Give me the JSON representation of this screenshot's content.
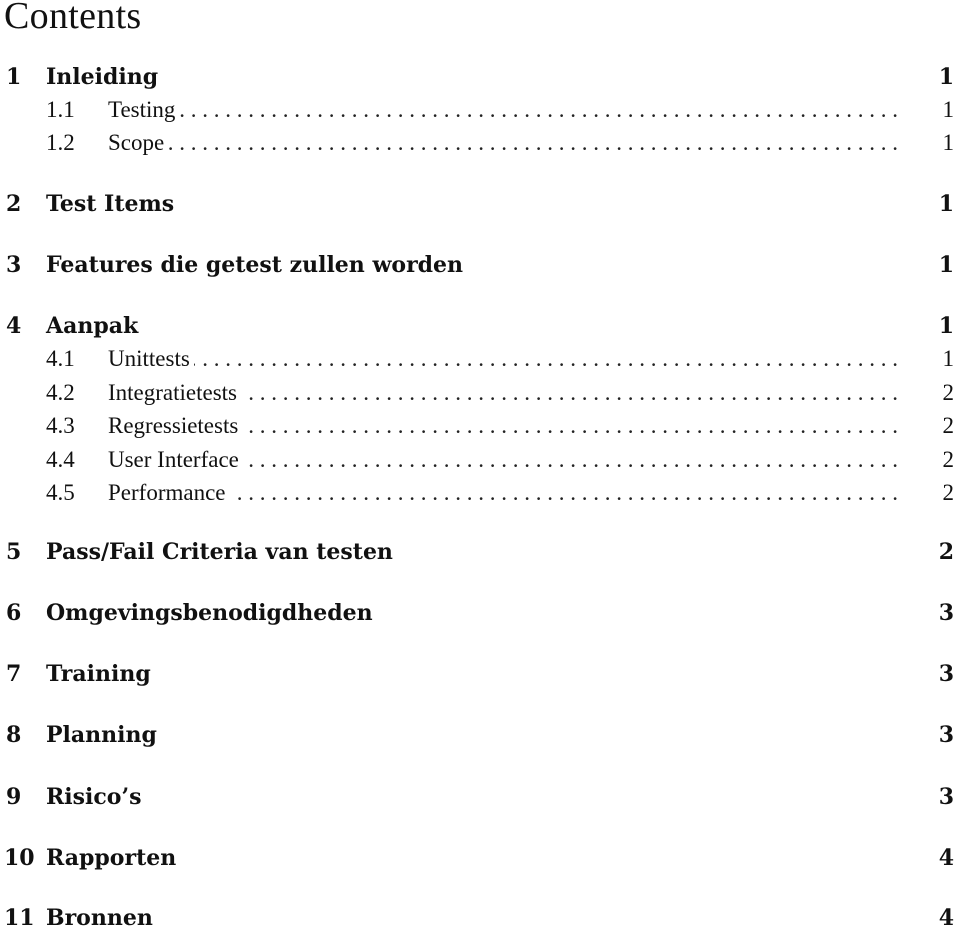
{
  "document": {
    "title": "Contents",
    "leader_text": ". . . . . . . . . . . . . . . . . . . . . . . . . . . . . . . . . . . . . . . . . . . . . . . . . . . . . . . . . . . . . . . . . . . . . . . .",
    "entries": [
      {
        "level": 1,
        "number": "1",
        "label": "Inleiding",
        "page": "1"
      },
      {
        "level": 2,
        "number": "1.1",
        "label": "Testing",
        "page": "1"
      },
      {
        "level": 2,
        "number": "1.2",
        "label": "Scope",
        "page": "1"
      },
      {
        "level": 1,
        "number": "2",
        "label": "Test Items",
        "page": "1"
      },
      {
        "level": 1,
        "number": "3",
        "label": "Features die getest zullen worden",
        "page": "1"
      },
      {
        "level": 1,
        "number": "4",
        "label": "Aanpak",
        "page": "1"
      },
      {
        "level": 2,
        "number": "4.1",
        "label": "Unittests",
        "page": "1"
      },
      {
        "level": 2,
        "number": "4.2",
        "label": "Integratietests",
        "page": "2"
      },
      {
        "level": 2,
        "number": "4.3",
        "label": "Regressietests",
        "page": "2"
      },
      {
        "level": 2,
        "number": "4.4",
        "label": "User Interface",
        "page": "2"
      },
      {
        "level": 2,
        "number": "4.5",
        "label": "Performance",
        "page": "2"
      },
      {
        "level": 1,
        "number": "5",
        "label": "Pass/Fail Criteria van testen",
        "page": "2"
      },
      {
        "level": 1,
        "number": "6",
        "label": "Omgevingsbenodigdheden",
        "page": "3"
      },
      {
        "level": 1,
        "number": "7",
        "label": "Training",
        "page": "3"
      },
      {
        "level": 1,
        "number": "8",
        "label": "Planning",
        "page": "3"
      },
      {
        "level": 1,
        "number": "9",
        "label": "Risico’s",
        "page": "3"
      },
      {
        "level": 1,
        "number": "10",
        "label": "Rapporten",
        "page": "4"
      },
      {
        "level": 1,
        "number": "11",
        "label": "Bronnen",
        "page": "4"
      }
    ]
  }
}
